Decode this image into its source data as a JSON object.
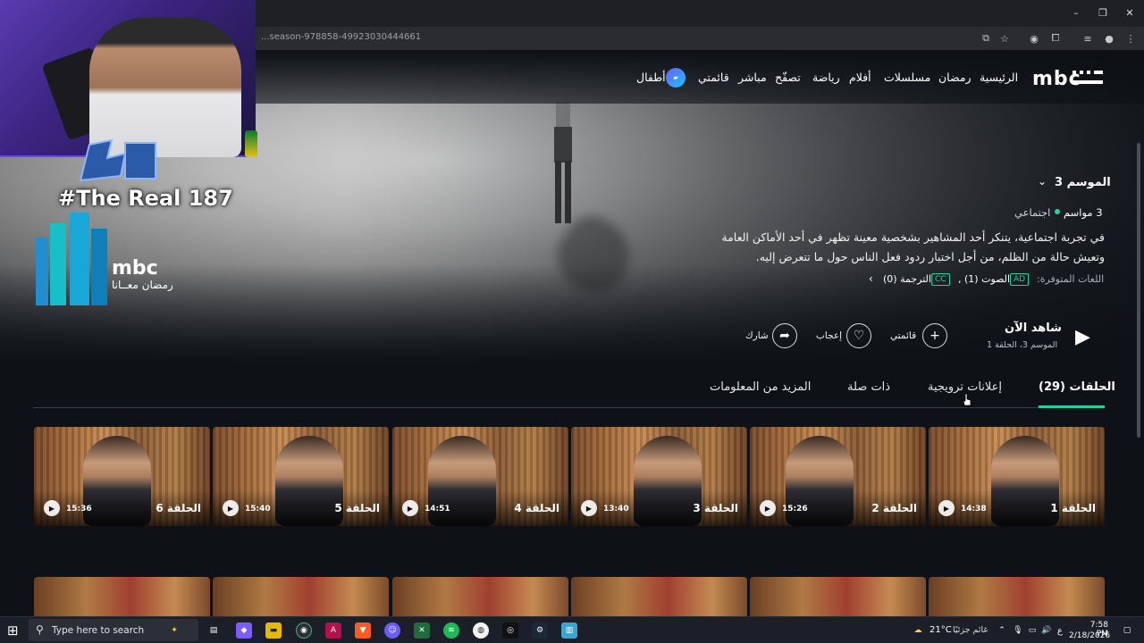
{
  "browser": {
    "url": "...season-978858-49923030444661",
    "window_controls": [
      "–",
      "❐",
      "✕"
    ]
  },
  "nav": {
    "logo": "mbc",
    "items": [
      {
        "label": "الرئيسية"
      },
      {
        "label": "رمضان"
      },
      {
        "label": "مسلسلات"
      },
      {
        "label": "أفلام"
      },
      {
        "label": "رياضة"
      },
      {
        "label": "تصفّح"
      },
      {
        "label": "مباشر"
      },
      {
        "label": "قائمتي"
      },
      {
        "label": "أطفال"
      }
    ]
  },
  "show": {
    "season_selector": "الموسم 3",
    "seasons_count": "3 مواسم",
    "genre": "اجتماعي",
    "description": "في تجربة اجتماعية، يتنكر أحد المشاهير بشخصية معينة تظهر في أحد الأماكن العامة وتعيش حالة من الظلم، من أجل اختبار ردود فعل الناس حول ما تتعرض إليه.",
    "languages_label": "اللغات المتوفرة:",
    "audio_tag": "AD",
    "audio_text": "الصوت (1) ,",
    "subtitle_tag": "CC",
    "subtitle_text": "الترجمة (0)"
  },
  "actions": {
    "watch_now": "شاهد الآن",
    "watch_sub": "الموسم 3، الحلقة 1",
    "mylist": "قائمتي",
    "like": "إعجاب",
    "share": "شارك"
  },
  "tabs": {
    "episodes": "الحلقات (29)",
    "promos": "إعلانات ترويجية",
    "related": "ذات صلة",
    "more_info": "المزيد من المعلومات"
  },
  "episodes": [
    {
      "title": "الحلقة 1",
      "duration": "14:38"
    },
    {
      "title": "الحلقة 2",
      "duration": "15:26"
    },
    {
      "title": "الحلقة 3",
      "duration": "13:40"
    },
    {
      "title": "الحلقة 4",
      "duration": "14:51"
    },
    {
      "title": "الحلقة 5",
      "duration": "15:40"
    },
    {
      "title": "الحلقة 6",
      "duration": "15:36"
    }
  ],
  "overlay": {
    "streamer_name": "#The Real 187",
    "ramadan_logo": "mbc",
    "ramadan_text": "رمضان معــانا"
  },
  "taskbar": {
    "search_placeholder": "Type here to search",
    "weather": "21°C",
    "weather_text": "غائم جزئيًا",
    "lang": "ع",
    "time": "7:58 PM",
    "date": "2/18/2026"
  },
  "colors": {
    "accent": "#22d3a0",
    "background": "#0e1116"
  }
}
